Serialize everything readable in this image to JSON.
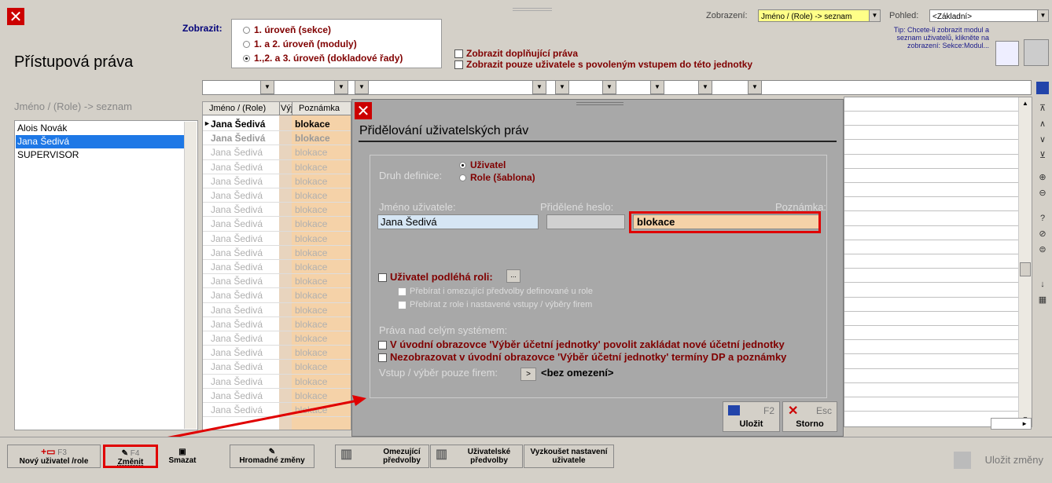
{
  "header": {
    "title": "Přístupová práva",
    "zobrazit_label": "Zobrazit:",
    "levels": [
      "1. úroveň (sekce)",
      "1. a 2. úroveň (moduly)",
      "1.,2. a 3. úroveň (dokladové řady)"
    ],
    "options": [
      "Zobrazit doplňující práva",
      "Zobrazit pouze uživatele s povoleným vstupem do této jednotky"
    ],
    "zobrazeni_label": "Zobrazení:",
    "zobrazeni_value": "Jméno / (Role) -> seznam",
    "pohled_label": "Pohled:",
    "pohled_value": "<Základní>",
    "tip": "Tip: Chcete-li zobrazit modul a seznam uživatelů, klikněte na zobrazení: Sekce:Modul..."
  },
  "left": {
    "title": "Jméno / (Role) -> seznam",
    "users": [
      "Alois Novák",
      "Jana Šedivá",
      "SUPERVISOR"
    ]
  },
  "grid": {
    "headers": [
      "Jméno / (Role)",
      "Výj",
      "Poznámka"
    ],
    "name": "Jana Šedivá",
    "note": "blokace",
    "row_count": 21
  },
  "dialog": {
    "title": "Přidělování uživatelských práv",
    "druh_label": "Druh definice:",
    "druh_options": [
      "Uživatel",
      "Role (šablona)"
    ],
    "jmeno_label": "Jméno uživatele:",
    "heslo_label": "Přidělené heslo:",
    "poznamka_label": "Poznámka:",
    "jmeno_value": "Jana Šedivá",
    "poznamka_value": "blokace",
    "role_label": "Uživatel podléhá roli:",
    "role_btn": "...",
    "role_sub": [
      "Přebírat i omezující předvolby definované u role",
      "Přebírat z role i nastavené vstupy / výběry firem"
    ],
    "system_label": "Práva nad celým systémem:",
    "system_opts": [
      "V úvodní obrazovce 'Výběr účetní jednotky' povolit zakládat nové účetní jednotky",
      "Nezobrazovat v úvodní obrazovce 'Výběr účetní jednotky' termíny DP a poznámky"
    ],
    "vstup_label": "Vstup / výběr pouze firem:",
    "vstup_btn": ">",
    "vstup_value": "<bez omezení>",
    "save_key": "F2",
    "save_label": "Uložit",
    "cancel_key": "Esc",
    "cancel_label": "Storno"
  },
  "toolbar": {
    "new_key": "F3",
    "new_label": "Nový uživatel /role",
    "edit_key": "F4",
    "edit_label": "Změnit",
    "delete_label": "Smazat",
    "bulk_label": "Hromadné změny",
    "restrict_label": "Omezující předvolby",
    "user_pref_label": "Uživatelské předvolby",
    "try_label": "Vyzkoušet nastavení uživatele",
    "save_changes_label": "Uložit změny"
  },
  "colors": {
    "accent_red": "#e00000",
    "maroon": "#800000",
    "note_bg": "#f5d2a8",
    "selection": "#1e78e6"
  }
}
